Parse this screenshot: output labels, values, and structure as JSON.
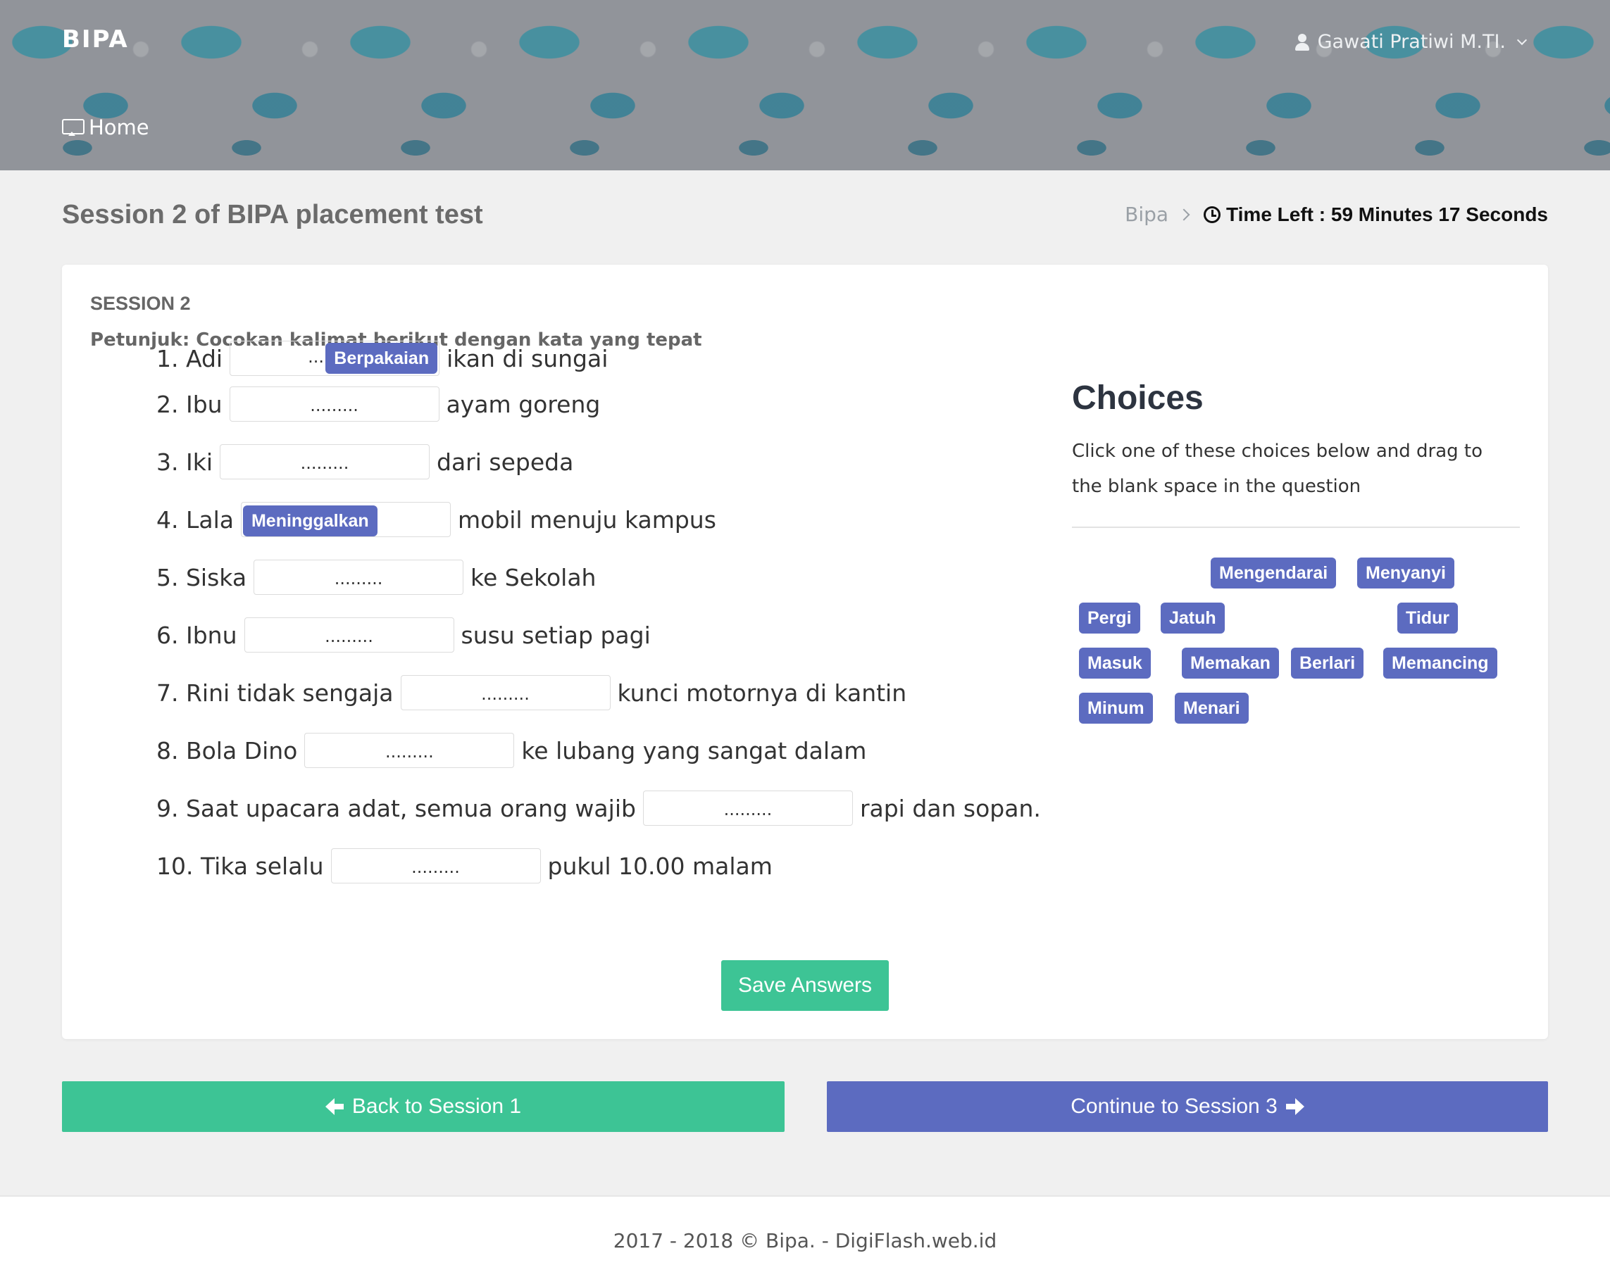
{
  "header": {
    "brand": "BIPA",
    "user_name": "Gawati Pratiwi M.TI.",
    "home_label": "Home"
  },
  "page": {
    "title": "Session 2 of BIPA placement test",
    "breadcrumb": "Bipa",
    "timer": "Time Left : 59 Minutes 17 Seconds"
  },
  "session": {
    "label": "SESSION 2",
    "instruction": "Petunjuk: Cocokan kalimat berikut dengan kata yang tepat",
    "questions": [
      {
        "before": "1. Adi",
        "blank": "...",
        "filled": "Berpakaian",
        "after": "ikan di sungai"
      },
      {
        "before": "2. Ibu",
        "blank": ".........",
        "filled": "",
        "after": "ayam goreng"
      },
      {
        "before": "3. Iki",
        "blank": ".........",
        "filled": "",
        "after": "dari sepeda"
      },
      {
        "before": "4. Lala",
        "blank": "",
        "filled": "Meninggalkan",
        "after": "mobil menuju kampus"
      },
      {
        "before": "5. Siska",
        "blank": ".........",
        "filled": "",
        "after": "ke Sekolah"
      },
      {
        "before": "6. Ibnu",
        "blank": ".........",
        "filled": "",
        "after": "susu setiap pagi"
      },
      {
        "before": "7. Rini tidak sengaja",
        "blank": ".........",
        "filled": "",
        "after": "kunci motornya di kantin"
      },
      {
        "before": "8. Bola Dino",
        "blank": ".........",
        "filled": "",
        "after": "ke lubang yang sangat dalam"
      },
      {
        "before": "9. Saat upacara adat, semua orang wajib",
        "blank": ".........",
        "filled": "",
        "after": "rapi dan sopan."
      },
      {
        "before": "10. Tika selalu",
        "blank": ".........",
        "filled": "",
        "after": "pukul 10.00 malam"
      }
    ],
    "save_label": "Save Answers"
  },
  "choices": {
    "title": "Choices",
    "help": "Click one of these choices below and drag to the blank space in the question",
    "items": [
      "Mengendarai",
      "Menyanyi",
      "Pergi",
      "Jatuh",
      "Tidur",
      "Masuk",
      "Memakan",
      "Berlari",
      "Memancing",
      "Minum",
      "Menari"
    ]
  },
  "nav": {
    "back_label": "Back to Session 1",
    "next_label": "Continue to Session 3"
  },
  "footer": {
    "text": "2017 - 2018 © Bipa. - DigiFlash.web.id"
  },
  "colors": {
    "accent_green": "#3dc495",
    "accent_indigo": "#5c6bc0"
  }
}
